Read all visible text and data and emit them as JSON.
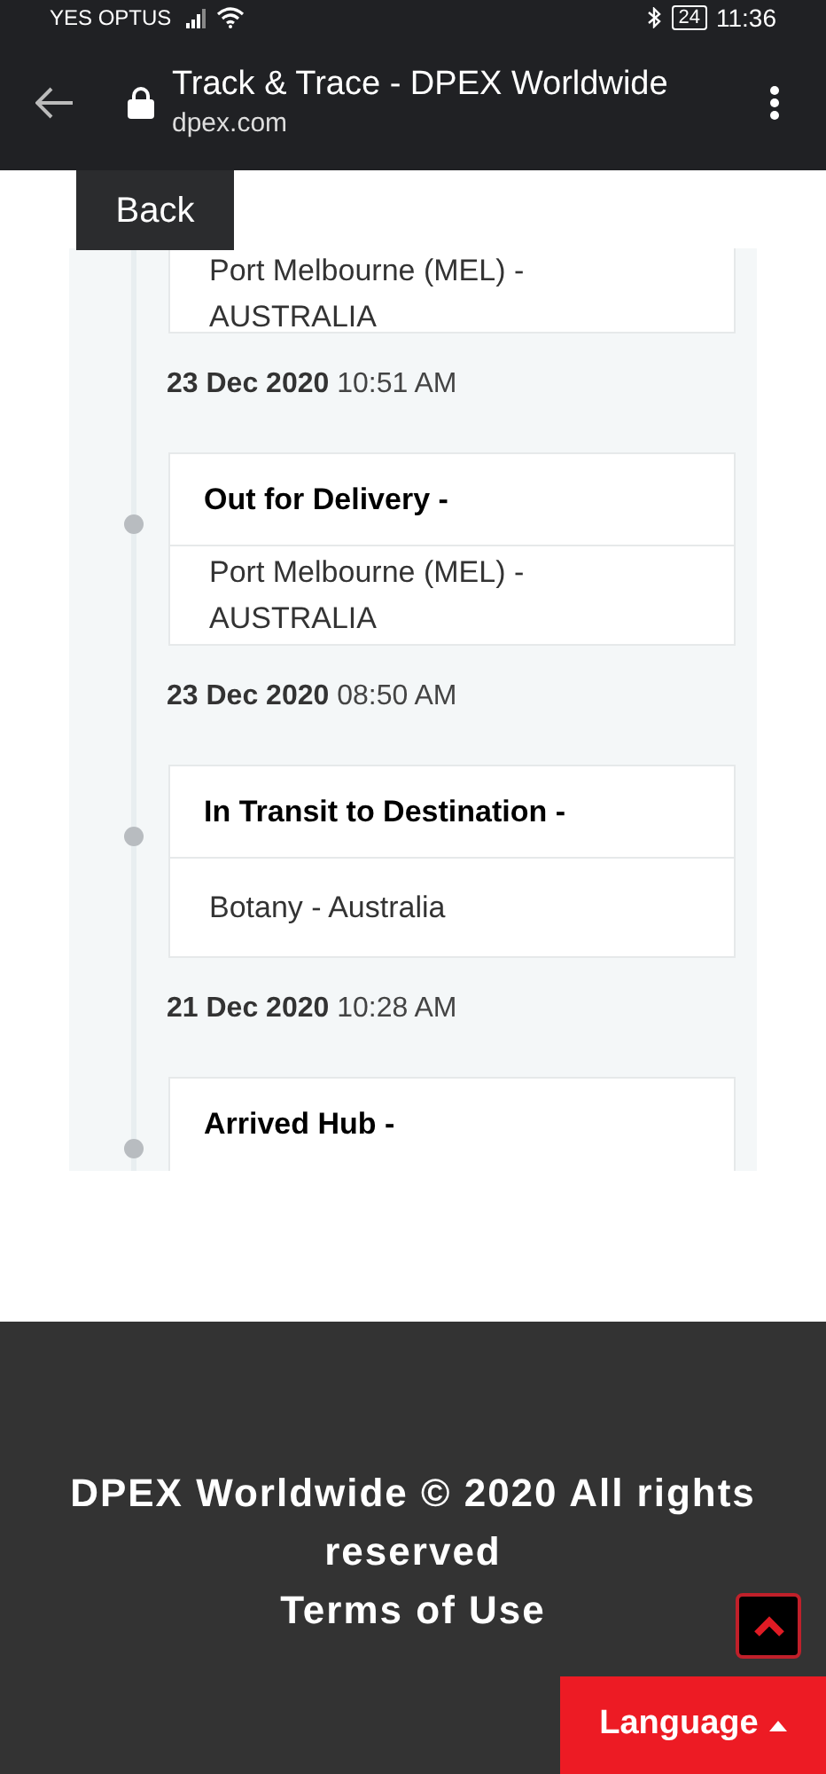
{
  "status_bar": {
    "carrier": "YES OPTUS",
    "battery": "24",
    "time": "11:36"
  },
  "browser": {
    "title": "Track & Trace - DPEX Worldwide",
    "url": "dpex.com"
  },
  "back_button": "Back",
  "events": [
    {
      "location": "Port Melbourne (MEL) - AUSTRALIA",
      "date": "23 Dec 2020",
      "time": "10:51 AM"
    },
    {
      "status": "Out for Delivery -",
      "location": "Port Melbourne (MEL) - AUSTRALIA",
      "date": "23 Dec 2020",
      "time": "08:50 AM"
    },
    {
      "status": "In Transit to Destination -",
      "location": "Botany - Australia",
      "date": "21 Dec 2020",
      "time": "10:28 AM"
    },
    {
      "status": "Arrived Hub -"
    }
  ],
  "footer": {
    "copyright": "DPEX Worldwide © 2020 All rights reserved",
    "terms": "Terms of Use"
  },
  "language_button": "Language"
}
